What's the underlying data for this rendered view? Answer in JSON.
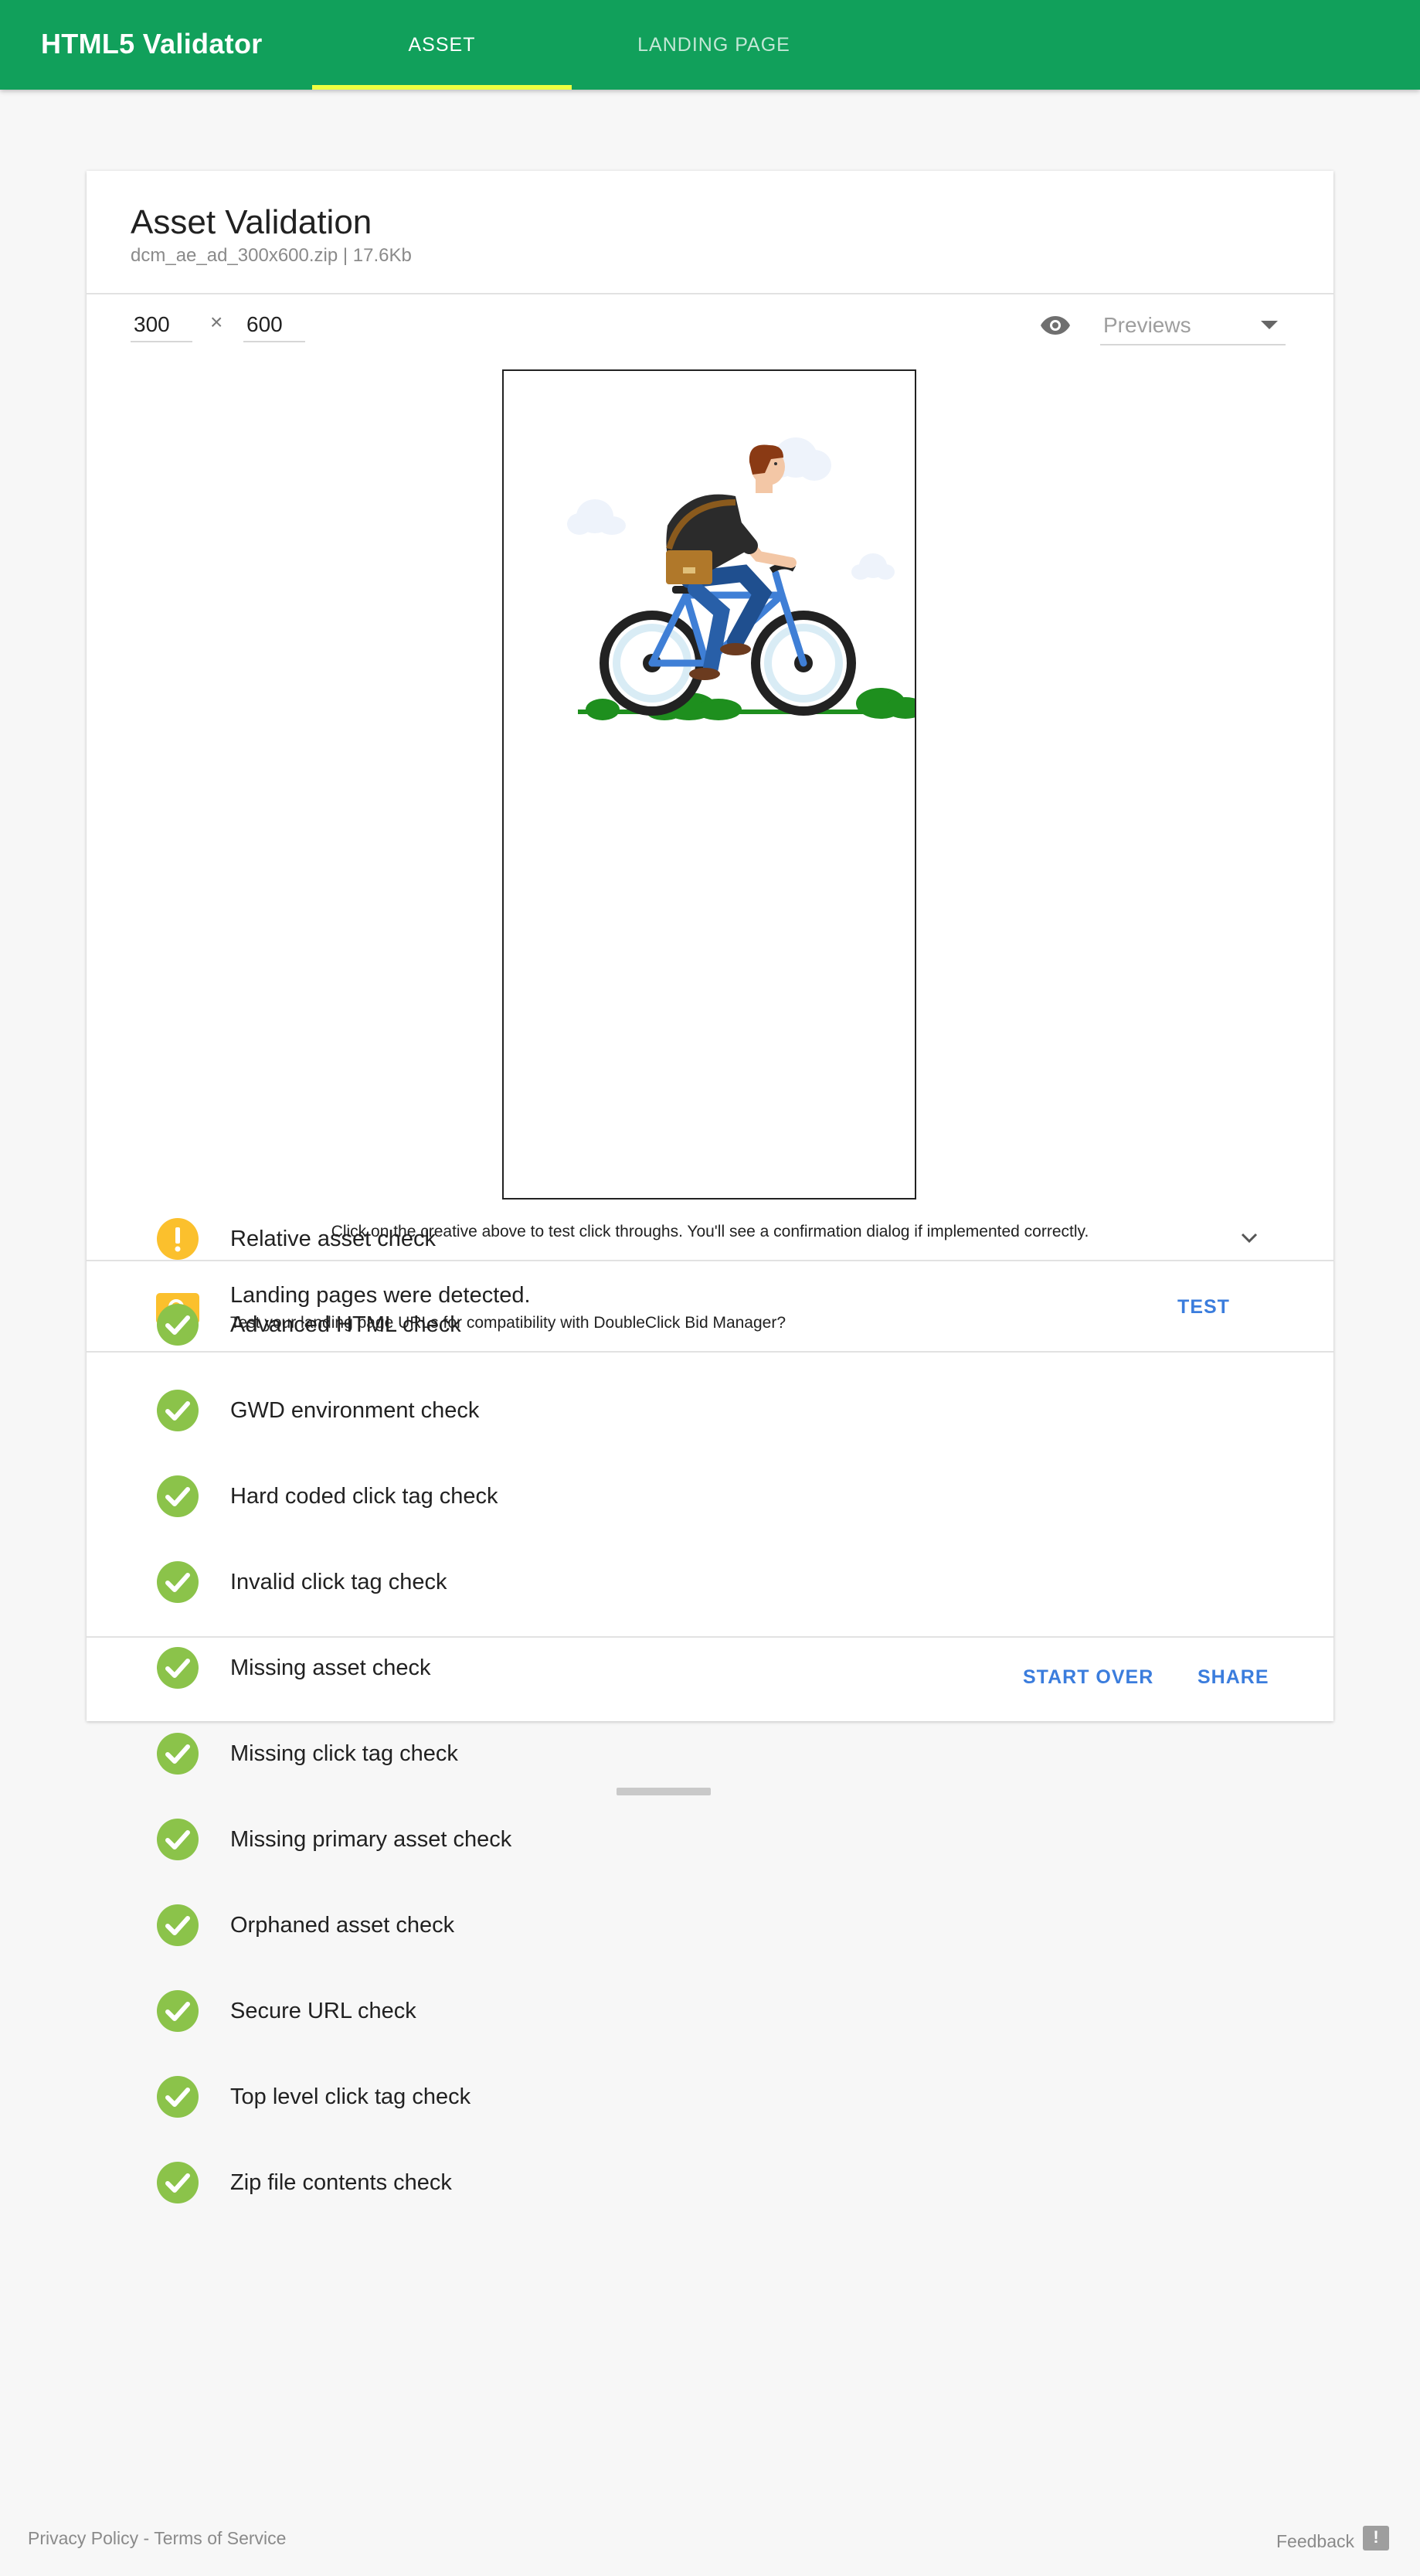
{
  "app": {
    "title": "HTML5 Validator",
    "tabs": [
      {
        "label": "ASSET",
        "active": true
      },
      {
        "label": "LANDING PAGE",
        "active": false
      }
    ]
  },
  "card": {
    "title": "Asset Validation",
    "subtitle": "dcm_ae_ad_300x600.zip | 17.6Kb",
    "width_value": "300",
    "separator": "×",
    "height_value": "600",
    "preview_select": {
      "selected": "Previews"
    },
    "click_hint": "Click on the creative above to test click throughs. You'll see a confirmation dialog if implemented correctly."
  },
  "landing_pages": {
    "title": "Landing pages were detected.",
    "subtitle": "Test your landing page URLs for compatibility with DoubleClick Bid Manager?",
    "test_label": "TEST"
  },
  "checks": [
    {
      "label": "Relative asset check",
      "status": "warning"
    },
    {
      "label": "Advanced HTML check",
      "status": "pass"
    },
    {
      "label": "GWD environment check",
      "status": "pass"
    },
    {
      "label": "Hard coded click tag check",
      "status": "pass"
    },
    {
      "label": "Invalid click tag check",
      "status": "pass"
    },
    {
      "label": "Missing asset check",
      "status": "pass"
    },
    {
      "label": "Missing click tag check",
      "status": "pass"
    },
    {
      "label": "Missing primary asset check",
      "status": "pass"
    },
    {
      "label": "Orphaned asset check",
      "status": "pass"
    },
    {
      "label": "Secure URL check",
      "status": "pass"
    },
    {
      "label": "Top level click tag check",
      "status": "pass"
    },
    {
      "label": "Zip file contents check",
      "status": "pass"
    }
  ],
  "actions": {
    "start_over": "START OVER",
    "share": "SHARE"
  },
  "footer": {
    "privacy": "Privacy Policy",
    "dash": " - ",
    "terms": "Terms of Service",
    "feedback": "Feedback",
    "feedback_icon": "!"
  },
  "colors": {
    "primary": "#11a05b",
    "tab_indicator": "#eeff41",
    "pass": "#8bc34a",
    "warning": "#fbc02d",
    "link": "#3b7ddd"
  },
  "icons": {
    "visibility": "eye-icon",
    "search": "search-icon",
    "pass": "check-circle-icon",
    "warning": "warning-icon",
    "expand": "chevron-down-icon"
  }
}
